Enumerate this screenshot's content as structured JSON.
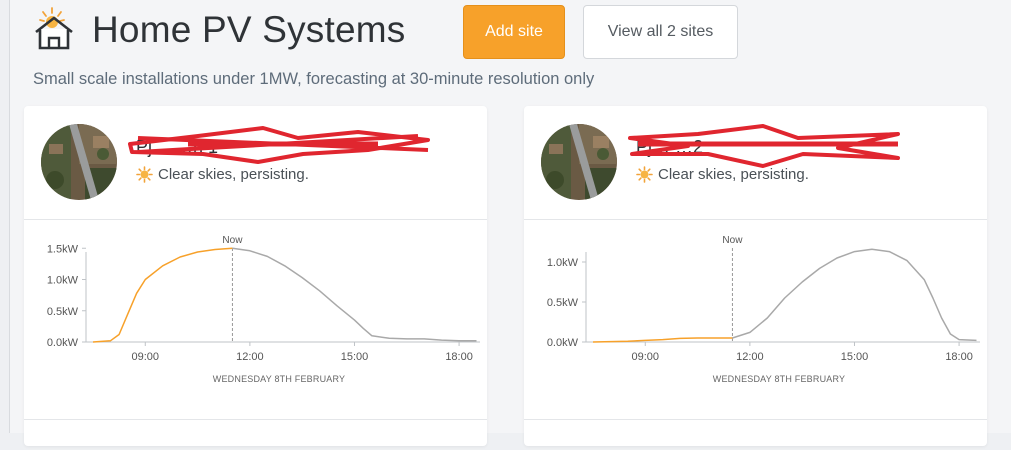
{
  "header": {
    "title": "Home PV Systems",
    "add_button": "Add site",
    "view_button": "View all 2 sites",
    "subtitle": "Small scale installations under 1MW, forecasting at 30-minute resolution only",
    "icon": "house-sun-icon"
  },
  "colors": {
    "accent": "#f7a12a",
    "forecast_line": "#a9a9a9",
    "redaction": "#e0262f"
  },
  "sites": [
    {
      "name": "Pj… …h 1",
      "weather": "Clear skies, persisting.",
      "weather_icon": "sun-icon",
      "chart_xlabel": "WEDNESDAY 8TH FEBRUARY",
      "now_label": "Now"
    },
    {
      "name": "Pj… …2",
      "weather": "Clear skies, persisting.",
      "weather_icon": "sun-icon",
      "chart_xlabel": "WEDNESDAY 8TH FEBRUARY",
      "now_label": "Now"
    }
  ],
  "chart_data": [
    {
      "type": "line",
      "xlabel": "WEDNESDAY 8TH FEBRUARY",
      "ylabel": "",
      "x_ticks": [
        "09:00",
        "12:00",
        "15:00",
        "18:00"
      ],
      "y_ticks": [
        "0.0kW",
        "0.5kW",
        "1.0kW",
        "1.5kW"
      ],
      "xlim": [
        7.3,
        18.6
      ],
      "ylim": [
        0,
        1.6
      ],
      "now": 11.5,
      "x": [
        7.5,
        8.0,
        8.25,
        8.5,
        8.75,
        9.0,
        9.5,
        10.0,
        10.5,
        11.0,
        11.5,
        12.0,
        12.5,
        13.0,
        13.5,
        14.0,
        14.5,
        15.0,
        15.25,
        15.5,
        16.0,
        16.5,
        17.0,
        17.5,
        18.0,
        18.5
      ],
      "series": [
        {
          "values": [
            0.0,
            0.02,
            0.12,
            0.45,
            0.78,
            1.0,
            1.22,
            1.36,
            1.44,
            1.48,
            1.5,
            1.46,
            1.37,
            1.22,
            1.03,
            0.82,
            0.58,
            0.35,
            0.22,
            0.1,
            0.06,
            0.05,
            0.05,
            0.03,
            0.02,
            0.02
          ]
        }
      ]
    },
    {
      "type": "line",
      "xlabel": "WEDNESDAY 8TH FEBRUARY",
      "ylabel": "",
      "x_ticks": [
        "09:00",
        "12:00",
        "15:00",
        "18:00"
      ],
      "y_ticks": [
        "0.0kW",
        "0.5kW",
        "1.0kW"
      ],
      "xlim": [
        7.3,
        18.6
      ],
      "ylim": [
        0,
        1.25
      ],
      "now": 11.5,
      "x": [
        7.5,
        8.0,
        8.5,
        9.0,
        9.5,
        10.0,
        10.5,
        11.0,
        11.5,
        12.0,
        12.5,
        13.0,
        13.5,
        14.0,
        14.5,
        15.0,
        15.5,
        16.0,
        16.5,
        17.0,
        17.25,
        17.5,
        17.75,
        18.0,
        18.5
      ],
      "series": [
        {
          "values": [
            0.0,
            0.005,
            0.01,
            0.02,
            0.03,
            0.045,
            0.05,
            0.05,
            0.05,
            0.12,
            0.3,
            0.55,
            0.75,
            0.92,
            1.05,
            1.13,
            1.16,
            1.13,
            1.02,
            0.78,
            0.55,
            0.3,
            0.1,
            0.03,
            0.02
          ]
        }
      ]
    }
  ]
}
